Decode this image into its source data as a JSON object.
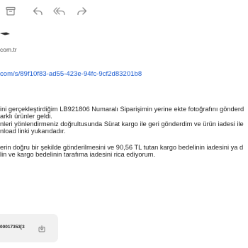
{
  "toolbar": {
    "buttons": [
      {
        "name": "archive",
        "icon": "archive-icon"
      },
      {
        "name": "reply",
        "icon": "reply-icon"
      },
      {
        "name": "reply-all",
        "icon": "reply-all-icon"
      },
      {
        "name": "forward",
        "icon": "forward-icon"
      }
    ]
  },
  "header": {
    "sender_email": "com.tr"
  },
  "body": {
    "link": "com/s/89f10f83-ad55-423e-94fc-9cf2d83201b8",
    "para1": [
      "ini gerçekleştirdiğim LB921806 Numaralı Siparişimin yerine ekte fotoğrafını gönderd",
      "arklı ürünler geldi.",
      "nleri yönlendirmeniz doğrultusunda Sürat kargo ile geri gönderdim ve ürün iadesi ile",
      "nload linki yukarıdadır."
    ],
    "para2": [
      "erin doğru bir şekilde gönderilmesini ve 90,56 TL tutan kargo bedelinin iadesini ya d",
      "lin ve kargo bedelinin tarafıma iadesini rica ediyorum."
    ]
  },
  "attachment": {
    "filename": "00017353[3",
    "icon": "download-icon"
  },
  "colors": {
    "link": "#1a5bd1",
    "icon": "#8a8a8a",
    "attachment_bg": "#f1f1f1"
  }
}
